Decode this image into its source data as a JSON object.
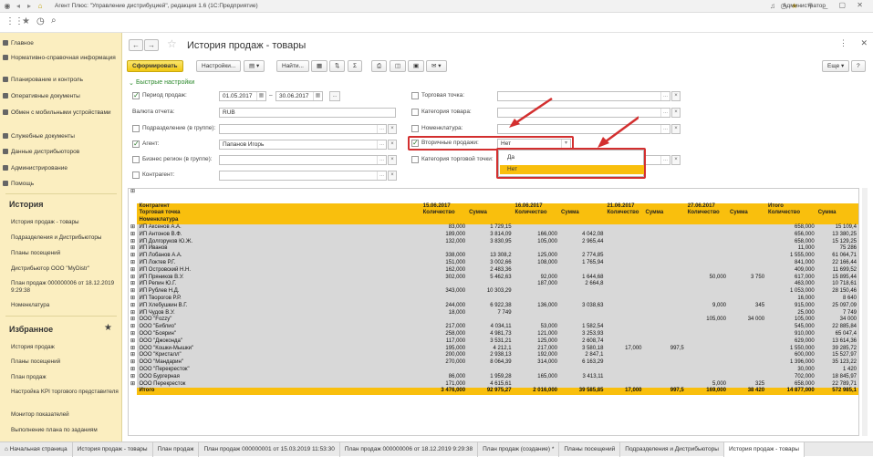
{
  "window": {
    "title": "Агент Плюс: \"Управление дистрибуцией\", редакция 1.6 (1С:Предприятие)",
    "user": "Администратор"
  },
  "sidebar": {
    "items": [
      "Главное",
      "Нормативно-справочная информация",
      "Планирование и контроль",
      "Оперативные документы",
      "Обмен с мобильными устройствами",
      "Служебные документы",
      "Данные дистрибьюторов",
      "Администрирование",
      "Помощь"
    ],
    "history_title": "История",
    "history": [
      "История продаж - товары",
      "Подразделения и Дистрибьюторы",
      "Планы посещений",
      "Дистрибьютор ООО \"MyDistr\"",
      "План продаж 000000006 от 18.12.2019 9:29:38",
      "Номенклатура"
    ],
    "favorites_title": "Избранное",
    "favorites": [
      "История продаж",
      "Планы посещений",
      "План продаж",
      "Настройка KPI торгового представителя",
      "Монитор показателей",
      "Выполнение плана по заданиям"
    ]
  },
  "doc": {
    "title": "История продаж - товары"
  },
  "cmd": {
    "generate": "Сформировать",
    "settings": "Настройки...",
    "find": "Найти...",
    "more": "Еще",
    "help": "?"
  },
  "quick": {
    "title": "Быстрые настройки",
    "period_label": "Период продаж:",
    "date_from": "01.05.2017",
    "date_to": "30.06.2017",
    "dash": "–",
    "currency_label": "Валюта отчета:",
    "currency": "RUB",
    "division_label": "Подразделение (в группе):",
    "agent_label": "Агент:",
    "agent": "Папанов Игорь",
    "region_label": "Бизнес регион (в группе):",
    "contractor_label": "Контрагент:",
    "outlet_label": "Торговая точка:",
    "goods_cat_label": "Категория товара:",
    "nomenclature_label": "Номенклатура:",
    "secondary_label": "Вторичные продажи:",
    "secondary_value": "Нет",
    "outlet_cat_label": "Категория торговой точки:",
    "options": [
      "Да",
      "Нет"
    ]
  },
  "report": {
    "head_rows": [
      "Контрагент",
      "Торговая точка",
      "Номенклатура"
    ],
    "dates": [
      "15.06.2017",
      "16.06.2017",
      "21.06.2017",
      "27.06.2017",
      "Итого"
    ],
    "qty": "Количество",
    "sum": "Сумма",
    "rows": [
      [
        "ИП Аксенов А.А.",
        "83,000",
        "1 729,15",
        "",
        "",
        "",
        "",
        "",
        "",
        "658,000",
        "15 109,4"
      ],
      [
        "ИП Антонов В.Ф.",
        "189,000",
        "3 814,09",
        "166,000",
        "4 042,08",
        "",
        "",
        "",
        "",
        "656,000",
        "13 380,25"
      ],
      [
        "ИП Долгоруков Ю.Ж.",
        "132,000",
        "3 830,95",
        "105,000",
        "2 965,44",
        "",
        "",
        "",
        "",
        "658,000",
        "15 129,25"
      ],
      [
        "ИП Иванов",
        "",
        "",
        "",
        "",
        "",
        "",
        "",
        "",
        "11,000",
        "75 286"
      ],
      [
        "ИП Лобанов А.А.",
        "338,000",
        "13 308,2",
        "125,000",
        "2 774,85",
        "",
        "",
        "",
        "",
        "1 555,000",
        "61 064,71"
      ],
      [
        "ИП Локтев Р.Г.",
        "151,000",
        "3 002,66",
        "108,000",
        "1 765,94",
        "",
        "",
        "",
        "",
        "841,000",
        "22 166,44"
      ],
      [
        "ИП Островский Н.Н.",
        "162,000",
        "2 483,36",
        "",
        "",
        "",
        "",
        "",
        "",
        "409,000",
        "11 699,52"
      ],
      [
        "ИП Пряников В.У.",
        "302,000",
        "5 462,63",
        "92,000",
        "1 644,68",
        "",
        "",
        "50,000",
        "3 750",
        "617,000",
        "15 895,44"
      ],
      [
        "ИП Репин Ю.Г.",
        "",
        "",
        "187,000",
        "2 664,8",
        "",
        "",
        "",
        "",
        "463,000",
        "10 718,61"
      ],
      [
        "ИП Рублев Н.Д.",
        "343,000",
        "10 303,29",
        "",
        "",
        "",
        "",
        "",
        "",
        "1 053,000",
        "28 150,46"
      ],
      [
        "ИП Творогов Р.Р.",
        "",
        "",
        "",
        "",
        "",
        "",
        "",
        "",
        "16,000",
        "8 640"
      ],
      [
        "ИП Хлебушкин В.Г.",
        "244,000",
        "6 922,38",
        "136,000",
        "3 038,63",
        "",
        "",
        "9,000",
        "345",
        "915,000",
        "25 097,09"
      ],
      [
        "ИП Чудов В.У.",
        "18,000",
        "7 749",
        "",
        "",
        "",
        "",
        "",
        "",
        "25,000",
        "7 749"
      ],
      [
        "ООО \"Fozzy\"",
        "",
        "",
        "",
        "",
        "",
        "",
        "105,000",
        "34 000",
        "105,000",
        "34 000"
      ],
      [
        "ООО \"Библио\"",
        "217,000",
        "4 034,11",
        "53,000",
        "1 582,54",
        "",
        "",
        "",
        "",
        "545,000",
        "22 885,84"
      ],
      [
        "ООО \"Боярин\"",
        "258,000",
        "4 981,73",
        "121,000",
        "3 253,93",
        "",
        "",
        "",
        "",
        "910,000",
        "65 047,4"
      ],
      [
        "ООО \"Джоконда\"",
        "117,000",
        "3 531,21",
        "125,000",
        "2 608,74",
        "",
        "",
        "",
        "",
        "629,000",
        "13 614,36"
      ],
      [
        "ООО \"Кошки-Мышки\"",
        "195,000",
        "4 212,1",
        "217,000",
        "3 580,18",
        "17,000",
        "997,5",
        "",
        "",
        "1 550,000",
        "39 285,72"
      ],
      [
        "ООО \"Кристалл\"",
        "200,000",
        "2 938,13",
        "192,000",
        "2 847,1",
        "",
        "",
        "",
        "",
        "600,000",
        "15 527,97"
      ],
      [
        "ООО \"Мандарин\"",
        "270,000",
        "8 064,39",
        "314,000",
        "6 163,29",
        "",
        "",
        "",
        "",
        "1 396,000",
        "35 123,22"
      ],
      [
        "ООО \"Перекресток\"",
        "",
        "",
        "",
        "",
        "",
        "",
        "",
        "",
        "30,000",
        "1 420"
      ],
      [
        "ООО Бургерная",
        "86,000",
        "1 959,28",
        "165,000",
        "3 413,11",
        "",
        "",
        "",
        "",
        "702,000",
        "18 845,97"
      ],
      [
        "ООО Перекресток",
        "171,000",
        "4 615,61",
        "",
        "",
        "",
        "",
        "5,000",
        "325",
        "658,000",
        "22 789,71"
      ]
    ],
    "total": [
      "Итого",
      "3 476,000",
      "92 975,27",
      "2 016,000",
      "39 585,85",
      "17,000",
      "997,5",
      "169,000",
      "38 420",
      "14 877,000",
      "572 985,1"
    ]
  },
  "tabs": [
    "Начальная страница",
    "История продаж - товары",
    "План продаж",
    "План продаж 000000001 от 15.03.2019 11:53:30",
    "План продаж 000000006 от 18.12.2019 9:29:38",
    "План продаж (создание) *",
    "Планы посещений",
    "Подразделения и Дистрибьюторы",
    "История продаж - товары"
  ],
  "colors": {
    "accent": "#f9bf0d",
    "sidebar": "#fbeec0",
    "highlight": "#d32f2f"
  }
}
